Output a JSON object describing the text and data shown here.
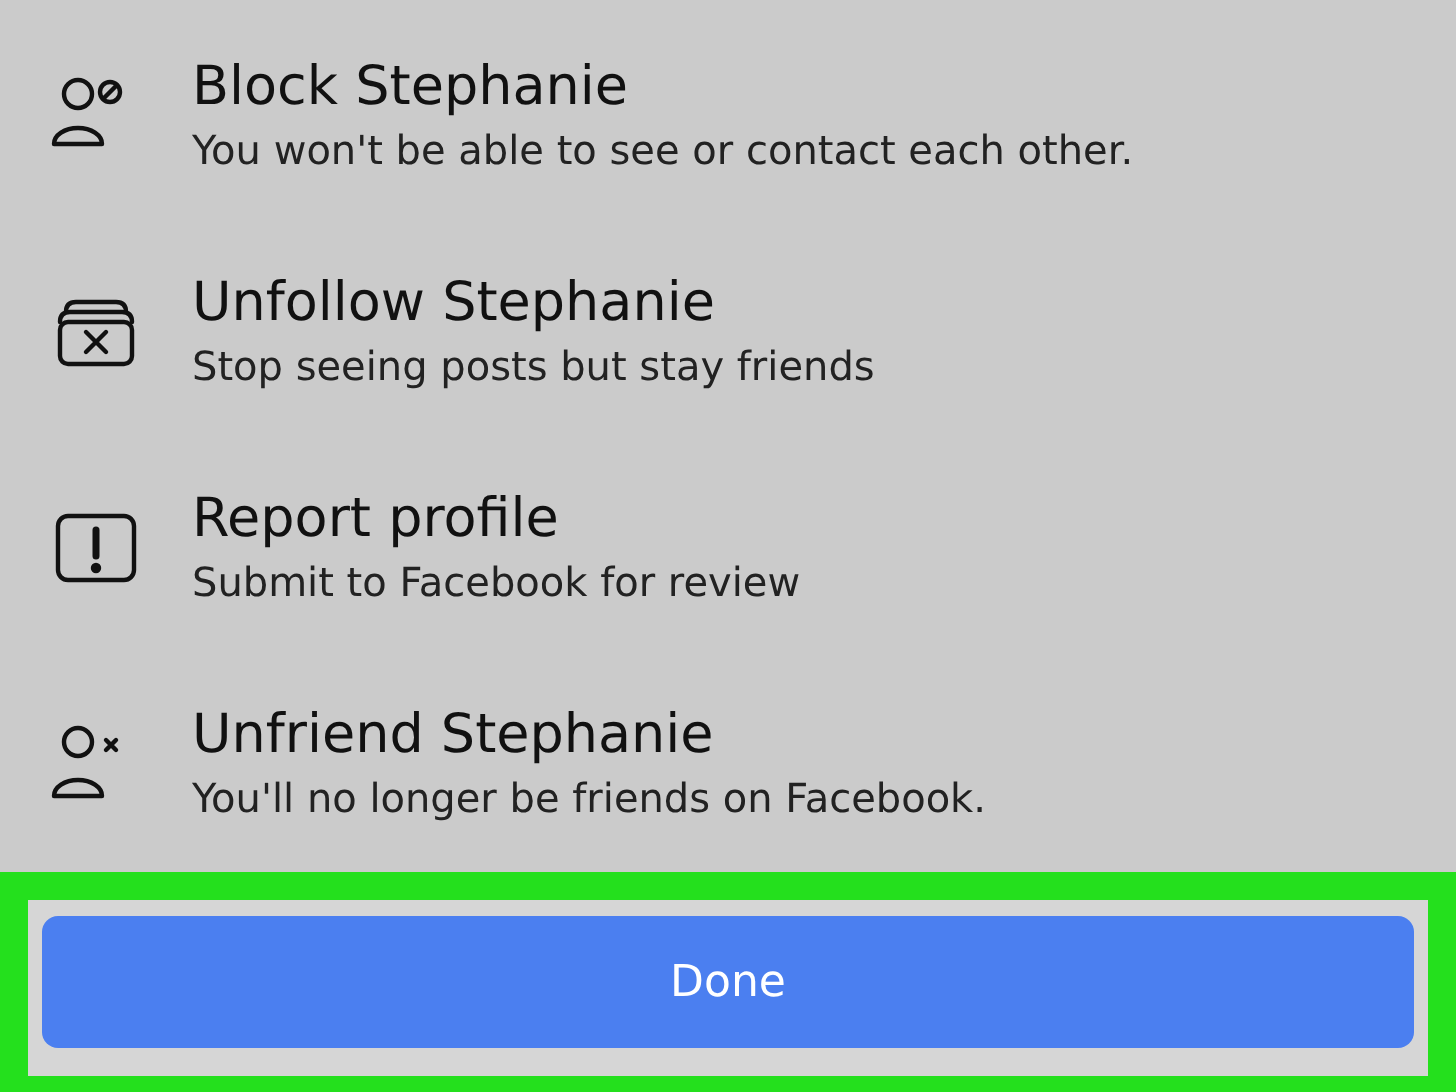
{
  "actions": [
    {
      "kind": "block",
      "title": "Block Stephanie",
      "subtitle": "You won't be able to see or contact each other."
    },
    {
      "kind": "unfollow",
      "title": "Unfollow Stephanie",
      "subtitle": "Stop seeing posts but stay friends"
    },
    {
      "kind": "report",
      "title": "Report profile",
      "subtitle": "Submit to Facebook for review"
    },
    {
      "kind": "unfriend",
      "title": "Unfriend Stephanie",
      "subtitle": "You'll no longer be friends on Facebook."
    }
  ],
  "done_button": {
    "label": "Done",
    "highlighted": true
  }
}
